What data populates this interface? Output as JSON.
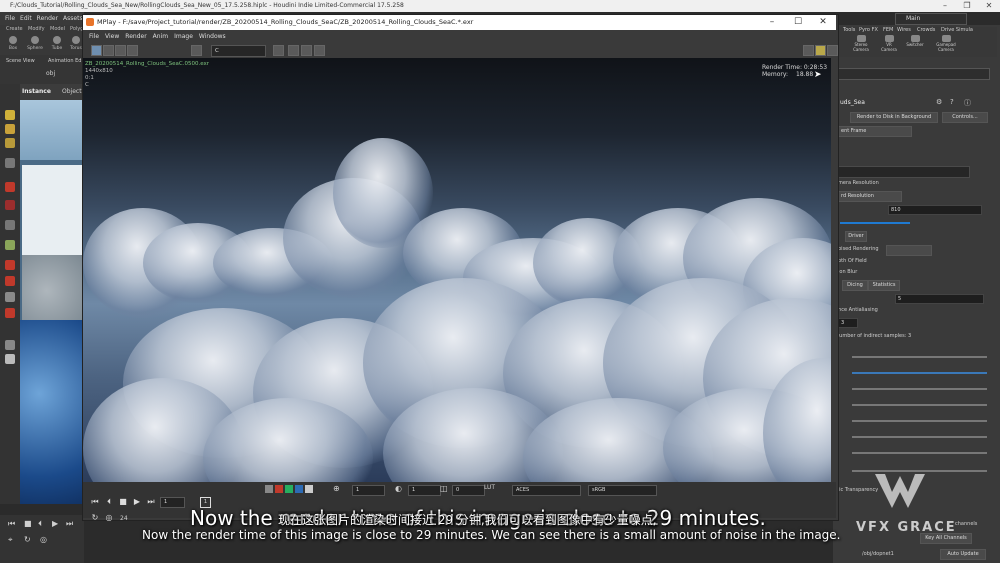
{
  "houdini": {
    "window_title": "F:/Clouds_Tutorial/Rolling_Clouds_Sea_New/RollingClouds_Sea_New_05_17.5.258.hiplc - Houdini Indie Limited-Commercial 17.5.258",
    "menu": [
      "File",
      "Edit",
      "Render",
      "Assets"
    ],
    "shelf_tabs": [
      "Create",
      "Modify",
      "Model",
      "Polyg"
    ],
    "shelf_items": [
      "Box",
      "Sphere",
      "Tube",
      "Torus"
    ],
    "right_shelf_tabs": [
      "Tools",
      "Pyro FX",
      "FEM",
      "Wires",
      "Crowds",
      "Drive Simula"
    ],
    "right_shelf_items": [
      "Stereo Camera",
      "VR Camera",
      "Switcher",
      "Gamepad Camera"
    ],
    "desktop": "Main",
    "scene_view_tabs": [
      "Scene View",
      "Animation Ed"
    ],
    "path": "obj",
    "viewer_labels": [
      "Instance",
      "Object"
    ],
    "params": {
      "node_name": "uds_Sea",
      "render_bg_button": "Render to Disk in Background",
      "controls_button": "Controls...",
      "frame_mode": "ent Frame",
      "camera_resolution_label": "mera Resolution",
      "resolution_mode": "rd Resolution",
      "res_value": "810",
      "driver_tab": "Driver",
      "rendering_label": "bised Rendering",
      "depth_of_field": "pth Of Field",
      "motion_blur": "ion Blur",
      "tabs": [
        "Dicing",
        "Statistics"
      ],
      "samples_value": "5",
      "antialiasing": "ance Antialiasing",
      "pixel_samples": "3",
      "indirect_samples": "number of indirect samples: 3",
      "transparency": "nic Transparency",
      "channels": "channels",
      "key_all_channels": "Key All Channels",
      "auto_update": "Auto Update",
      "node_path": "/obj/dopnet1"
    }
  },
  "mplay": {
    "title": "MPlay - F:/save/Project_tutorial/render/ZB_20200514_Rolling_Clouds_SeaC/ZB_20200514_Rolling_Clouds_SeaC.*.exr",
    "menu": [
      "File",
      "View",
      "Render",
      "Anim",
      "Image",
      "Windows"
    ],
    "channel": "C",
    "image": {
      "filename": "ZB_20200514_Rolling_Clouds_SeaC.0500.exr",
      "resolution": "1440x810",
      "ratio": "0:1",
      "plane": "C",
      "render_time_label": "Render Time: 0:28:53",
      "memory_label": "Memory:",
      "memory_value": "18.88"
    },
    "controls": {
      "frame_value": "1",
      "frame_end": "1",
      "field_1": "1",
      "field_2": "1",
      "field_3": "0",
      "color_space": "ACES",
      "output_space": "sRGB",
      "playback_speed": "24"
    }
  },
  "subtitles": {
    "en_large": "Now the render time of this image is close to 29 minutes.",
    "cn": "现在这张图片的渲染时间接近 29 分钟,我们可以看到图像中有少量噪点,",
    "en": "Now the render time of this image is close to 29 minutes. We can see there is a small amount of noise in the image."
  },
  "watermark": {
    "text": "VFX GRACE"
  },
  "colors": {
    "mplay_title_bg": "#ffffff",
    "panel_bg": "#3a3a3a",
    "info_text_green": "#7ec27e"
  }
}
